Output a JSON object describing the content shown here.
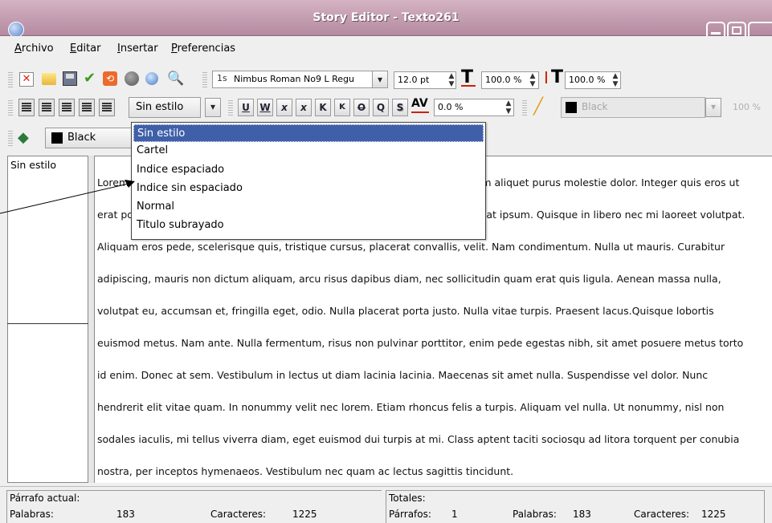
{
  "window": {
    "title": "Story Editor - Texto261"
  },
  "menu": {
    "items": [
      {
        "label": "Archivo",
        "ul": "A",
        "rest": "rchivo"
      },
      {
        "label": "Editar",
        "ul": "E",
        "rest": "ditar"
      },
      {
        "label": "Insertar",
        "ul": "I",
        "rest": "nsertar"
      },
      {
        "label": "Preferencias",
        "ul": "P",
        "rest": "referencias"
      }
    ]
  },
  "toolbar1": {
    "font_name": "Nimbus Roman No9 L Regu",
    "font_size": "12.0 pt",
    "scale_h": "100.0 %",
    "scale_v": "100.0 %"
  },
  "toolbar2": {
    "style_select": "Sin estilo",
    "tracking": "0.0 %",
    "stroke_color": "Black",
    "stroke_shade": "100 %",
    "char_buttons": [
      "U",
      "W",
      "x",
      "x",
      "K",
      "K",
      "O",
      "Q",
      "S",
      "AV"
    ]
  },
  "toolbar3": {
    "fill_color": "Black"
  },
  "colors": {
    "titlebar": "#b48aa0",
    "selection": "#3f5fa8",
    "accent_red": "#cc2200"
  },
  "style_dropdown": {
    "options": [
      "Sin estilo",
      "Cartel",
      "Indice espaciado",
      "Indice sin espaciado",
      "Normal",
      "Titulo subrayado"
    ],
    "selected_index": 0
  },
  "style_pane": {
    "first_style": "Sin estilo"
  },
  "editor": {
    "lines": [
      "Lorem ipsum dolor sit amet, consectetuer adipiscing elit. Ut a sapien. Aliquam aliquet purus molestie dolor. Integer quis eros ut",
      "erat posuere dictum. Curabitur dignissim. Integer orci. Fusce vulputate lacus at ipsum. Quisque in libero nec mi laoreet volutpat.",
      "Aliquam eros pede, scelerisque quis, tristique cursus, placerat convallis, velit. Nam condimentum. Nulla ut mauris. Curabitur",
      "adipiscing, mauris non dictum aliquam, arcu risus dapibus diam, nec sollicitudin quam erat quis ligula. Aenean massa nulla,",
      "volutpat eu, accumsan et, fringilla eget, odio. Nulla placerat porta justo. Nulla vitae turpis. Praesent lacus.Quisque lobortis",
      "euismod metus. Nam ante. Nulla fermentum, risus non pulvinar porttitor, enim pede egestas nibh, sit amet posuere metus torto",
      "id enim. Donec at sem. Vestibulum in lectus ut diam lacinia lacinia. Maecenas sit amet nulla. Suspendisse vel dolor. Nunc",
      "hendrerit elit vitae quam. In nonummy velit nec lorem. Etiam rhoncus felis a turpis. Aliquam vel nulla. Ut nonummy, nisl non",
      "sodales iaculis, mi tellus viverra diam, eget euismod dui turpis at mi. Class aptent taciti sociosqu ad litora torquent per conubia",
      "nostra, per inceptos hymenaeos. Vestibulum nec quam ac lectus sagittis tincidunt."
    ]
  },
  "status": {
    "current_para_label": "Párrafo actual:",
    "words_label": "Palabras:",
    "words_value": "183",
    "chars_label": "Caracteres:",
    "chars_value": "1225",
    "totals_label": "Totales:",
    "paras_label": "Párrafos:",
    "paras_value": "1",
    "total_words_label": "Palabras:",
    "total_words_value": "183",
    "total_chars_label": "Caracteres:",
    "total_chars_value": "1225"
  }
}
